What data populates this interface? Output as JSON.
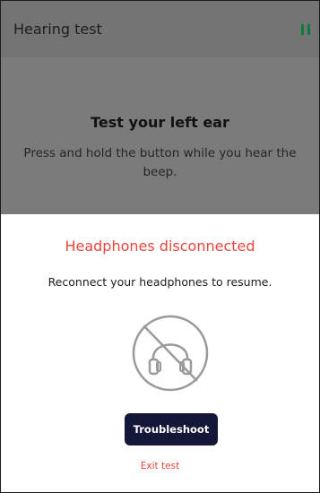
{
  "app_bar": {
    "title": "Hearing test",
    "pause_icon": "pause-icon"
  },
  "test": {
    "heading": "Test your left ear",
    "instruction": "Press and hold the button while you hear the beep."
  },
  "sheet": {
    "title": "Headphones disconnected",
    "message": "Reconnect your headphones to resume.",
    "icon": "headphones-disconnected-icon",
    "primary_button_label": "Troubleshoot",
    "exit_label": "Exit test"
  },
  "colors": {
    "accent_red": "#e8463d",
    "button_navy": "#141737",
    "pause_green": "#0f7a3f",
    "overlay_gray": "#7b7b7b"
  }
}
